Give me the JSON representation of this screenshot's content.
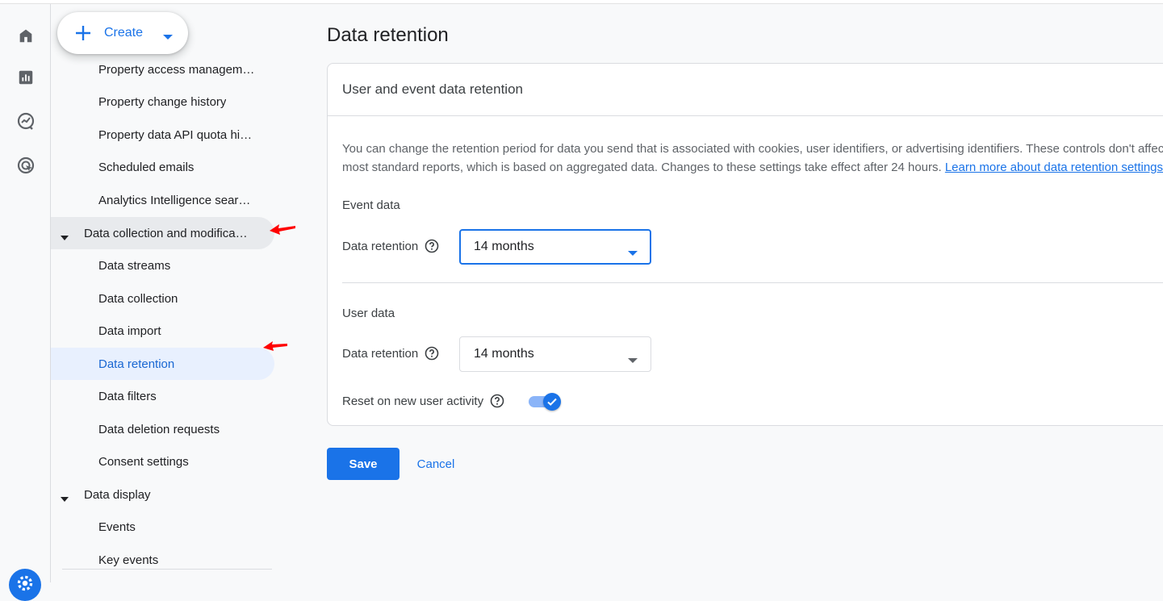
{
  "rail": {
    "items": [
      "home-icon",
      "reports-icon",
      "explore-icon",
      "advertising-icon"
    ],
    "settings_icon": "settings-gear-icon"
  },
  "nav": {
    "create_label": "Create",
    "items": [
      {
        "label": "Property access managem…",
        "level": "sub"
      },
      {
        "label": "Property change history",
        "level": "sub"
      },
      {
        "label": "Property data API quota hi…",
        "level": "sub"
      },
      {
        "label": "Scheduled emails",
        "level": "sub"
      },
      {
        "label": "Analytics Intelligence sear…",
        "level": "sub"
      },
      {
        "label": "Data collection and modifica…",
        "level": "group",
        "expanded": true
      },
      {
        "label": "Data streams",
        "level": "sub"
      },
      {
        "label": "Data collection",
        "level": "sub"
      },
      {
        "label": "Data import",
        "level": "sub"
      },
      {
        "label": "Data retention",
        "level": "sub",
        "active": true
      },
      {
        "label": "Data filters",
        "level": "sub"
      },
      {
        "label": "Data deletion requests",
        "level": "sub"
      },
      {
        "label": "Consent settings",
        "level": "sub"
      },
      {
        "label": "Data display",
        "level": "group",
        "expanded": true
      },
      {
        "label": "Events",
        "level": "sub"
      },
      {
        "label": "Key events",
        "level": "sub"
      }
    ]
  },
  "page": {
    "title": "Data retention",
    "card_title": "User and event data retention",
    "description": "You can change the retention period for data you send that is associated with cookies, user identifiers, or advertising identifiers. These controls don't affect most standard reports, which is based on aggregated data. Changes to these settings take effect after 24 hours. ",
    "learn_more": "Learn more about data retention settings",
    "event_section": "Event data",
    "event_retention_label": "Data retention",
    "event_retention_value": "14 months",
    "user_section": "User data",
    "user_retention_label": "Data retention",
    "user_retention_value": "14 months",
    "reset_label": "Reset on new user activity",
    "reset_enabled": true,
    "save": "Save",
    "cancel": "Cancel"
  },
  "colors": {
    "accent": "#1a73e8",
    "annotation_arrow": "#ff0000"
  }
}
